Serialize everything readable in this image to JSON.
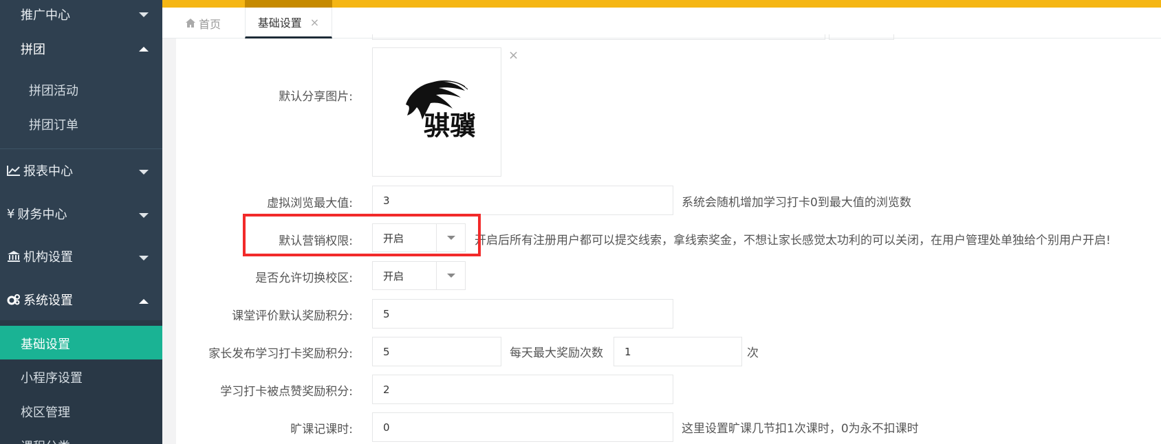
{
  "sidebar": {
    "groups": [
      {
        "label": "推广中心"
      },
      {
        "label": "拼团"
      },
      {
        "label": "报表中心"
      },
      {
        "label": "财务中心"
      },
      {
        "label": "机构设置"
      },
      {
        "label": "系统设置"
      }
    ],
    "pintuan_items": [
      {
        "label": "拼团活动"
      },
      {
        "label": "拼团订单"
      }
    ],
    "system_items": [
      {
        "label": "基础设置"
      },
      {
        "label": "小程序设置"
      },
      {
        "label": "校区管理"
      },
      {
        "label": "课程分类"
      }
    ],
    "finance_symbol": "¥"
  },
  "tabs": {
    "home": "首页",
    "basic": "基础设置",
    "close_symbol": "×"
  },
  "form": {
    "share_image": {
      "label": "默认分享图片:",
      "remove_symbol": "×",
      "logo_text": "骐骥"
    },
    "max_views": {
      "label": "虚拟浏览最大值:",
      "value": "3",
      "hint": "系统会随机增加学习打卡0到最大值的浏览数"
    },
    "marketing": {
      "label": "默认营销权限:",
      "value": "开启",
      "hint": "开启后所有注册用户都可以提交线索，拿线索奖金，不想让家长感觉太功利的可以关闭，在用户管理处单独给个别用户开启!"
    },
    "campus_switch": {
      "label": "是否允许切换校区:",
      "value": "开启"
    },
    "class_review_points": {
      "label": "课堂评价默认奖励积分:",
      "value": "5"
    },
    "parent_post_points": {
      "label": "家长发布学习打卡奖励积分:",
      "value": "5",
      "daily_label": "每天最大奖励次数",
      "daily_value": "1",
      "daily_unit": "次"
    },
    "like_points": {
      "label": "学习打卡被点赞奖励积分:",
      "value": "2"
    },
    "absence": {
      "label": "旷课记课时:",
      "value": "0",
      "hint": "这里设置旷课几节扣1次课时，0为永不扣课时"
    }
  }
}
